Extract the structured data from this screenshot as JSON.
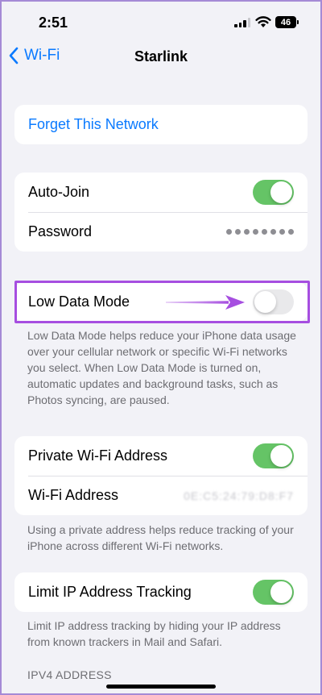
{
  "status_bar": {
    "time": "2:51",
    "battery_level": "46"
  },
  "nav": {
    "back_label": "Wi-Fi",
    "title": "Starlink"
  },
  "forget": {
    "label": "Forget This Network"
  },
  "auto_join": {
    "label": "Auto-Join",
    "enabled": true
  },
  "password": {
    "label": "Password",
    "masked": "••••••••"
  },
  "low_data_mode": {
    "label": "Low Data Mode",
    "enabled": false,
    "description": "Low Data Mode helps reduce your iPhone data usage over your cellular network or specific Wi-Fi networks you select. When Low Data Mode is turned on, automatic updates and background tasks, such as Photos syncing, are paused."
  },
  "private_address": {
    "label": "Private Wi-Fi Address",
    "enabled": true
  },
  "wifi_address": {
    "label": "Wi-Fi Address",
    "value": "0E:C5:24:79:D8:F7"
  },
  "private_address_description": "Using a private address helps reduce tracking of your iPhone across different Wi-Fi networks.",
  "limit_ip": {
    "label": "Limit IP Address Tracking",
    "enabled": true,
    "description": "Limit IP address tracking by hiding your IP address from known trackers in Mail and Safari."
  },
  "ipv4_header": "IPV4 ADDRESS",
  "colors": {
    "accent": "#0a7aff",
    "toggle_on": "#65c466",
    "highlight": "#a64ee0"
  }
}
